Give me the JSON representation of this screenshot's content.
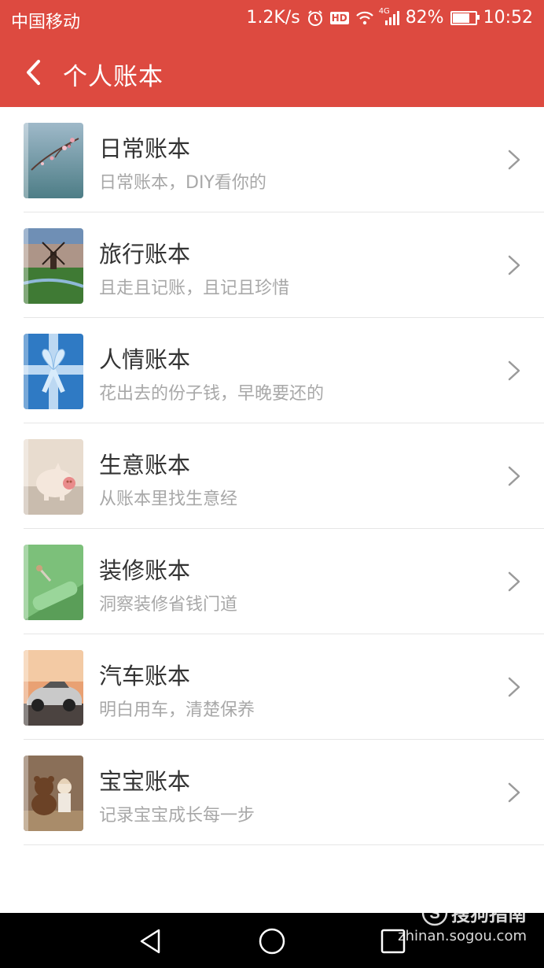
{
  "status_bar": {
    "carrier": "中国移动",
    "speed": "1.2K/s",
    "hd": "HD",
    "network": "4G",
    "battery": "82%",
    "battery_level": 0.82,
    "time": "10:52"
  },
  "app_bar": {
    "title": "个人账本",
    "color": "#dd4a40"
  },
  "books": [
    {
      "title": "日常账本",
      "subtitle": "日常账本，DIY看你的",
      "image": "flower-branch"
    },
    {
      "title": "旅行账本",
      "subtitle": "且走且记账，且记且珍惜",
      "image": "windmill-landscape"
    },
    {
      "title": "人情账本",
      "subtitle": "花出去的份子钱，早晚要还的",
      "image": "gift-ribbon"
    },
    {
      "title": "生意账本",
      "subtitle": "从账本里找生意经",
      "image": "piggy-bank"
    },
    {
      "title": "装修账本",
      "subtitle": "洞察装修省钱门道",
      "image": "paint-roller"
    },
    {
      "title": "汽车账本",
      "subtitle": "明白用车，清楚保养",
      "image": "sports-car"
    },
    {
      "title": "宝宝账本",
      "subtitle": "记录宝宝成长每一步",
      "image": "teddy-bear"
    }
  ],
  "watermark": {
    "brand": "搜狗指南",
    "url": "zhinan.sogou.com"
  }
}
